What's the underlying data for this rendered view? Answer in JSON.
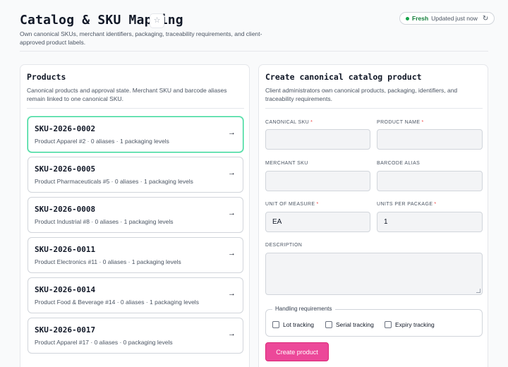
{
  "header": {
    "title": "Catalog & SKU Mapping",
    "star_icon": "star-icon",
    "subtitle": "Own canonical SKUs, merchant identifiers, packaging, traceability requirements, and client-approved product labels.",
    "status": {
      "fresh_label": "Fresh",
      "updated_label": "Updated just now",
      "refresh_icon": "refresh-icon",
      "dot_color": "#16a34a"
    }
  },
  "products": {
    "title": "Products",
    "description": "Canonical products and approval state. Merchant SKU and barcode aliases remain linked to one canonical SKU.",
    "items": [
      {
        "sku": "SKU-2026-0002",
        "meta": "Product Apparel #2 · 0 aliases · 1 packaging levels",
        "selected": true
      },
      {
        "sku": "SKU-2026-0005",
        "meta": "Product Pharmaceuticals #5 · 0 aliases · 1 packaging levels",
        "selected": false
      },
      {
        "sku": "SKU-2026-0008",
        "meta": "Product Industrial #8 · 0 aliases · 1 packaging levels",
        "selected": false
      },
      {
        "sku": "SKU-2026-0011",
        "meta": "Product Electronics #11 · 0 aliases · 1 packaging levels",
        "selected": false
      },
      {
        "sku": "SKU-2026-0014",
        "meta": "Product Food & Beverage #14 · 0 aliases · 1 packaging levels",
        "selected": false
      },
      {
        "sku": "SKU-2026-0017",
        "meta": "Product Apparel #17 · 0 aliases · 0 packaging levels",
        "selected": false
      }
    ]
  },
  "create_form": {
    "title": "Create canonical catalog product",
    "description": "Client administrators own canonical products, packaging, identifiers, and traceability requirements.",
    "fields": {
      "canonical_sku": {
        "label": "CANONICAL SKU",
        "value": ""
      },
      "product_name": {
        "label": "PRODUCT NAME",
        "value": ""
      },
      "merchant_sku": {
        "label": "MERCHANT SKU",
        "value": ""
      },
      "barcode_alias": {
        "label": "BARCODE ALIAS",
        "value": ""
      },
      "unit_of_measure": {
        "label": "UNIT OF MEASURE",
        "value": "EA"
      },
      "units_per_package": {
        "label": "UNITS PER PACKAGE",
        "value": "1"
      },
      "description": {
        "label": "DESCRIPTION",
        "value": ""
      }
    },
    "required_marker": "*",
    "handling": {
      "legend": "Handling requirements",
      "options": [
        {
          "label": "Lot tracking",
          "checked": false
        },
        {
          "label": "Serial tracking",
          "checked": false
        },
        {
          "label": "Expiry tracking",
          "checked": false
        }
      ]
    },
    "submit_label": "Create product",
    "accent_color": "#ec4899"
  }
}
